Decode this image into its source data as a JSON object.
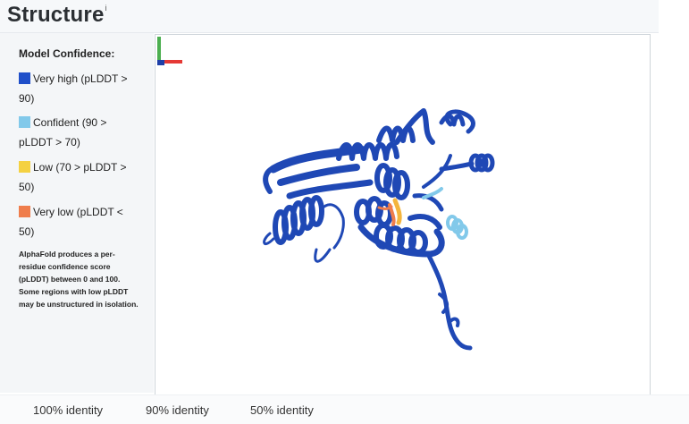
{
  "header": {
    "title": "Structure",
    "info_marker": "i"
  },
  "legend": {
    "title": "Model Confidence:",
    "items": [
      {
        "label": "Very high (pLDDT > 90)",
        "line1": "Very high (pLDDT >",
        "line2": "90)",
        "color": "#1f4fc9"
      },
      {
        "label": "Confident (90 > pLDDT > 70)",
        "line1": "Confident (90 >",
        "line2": "pLDDT > 70)",
        "color": "#82c9ea"
      },
      {
        "label": "Low (70 > pLDDT > 50)",
        "line1": "Low (70 > pLDDT >",
        "line2": "50)",
        "color": "#f4d142"
      },
      {
        "label": "Very low (pLDDT < 50)",
        "line1": "Very low (pLDDT <",
        "line2": "50)",
        "color": "#ef7d4c"
      }
    ],
    "note_lines": [
      "AlphaFold produces a per-",
      "residue confidence score",
      "(pLDDT) between 0 and 100.",
      "Some regions with low pLDDT",
      "may be unstructured in isolation."
    ]
  },
  "viewer": {
    "main_color": "#1f48b5",
    "accent_light": "#82c9ea",
    "accent_low": "#f4b53d",
    "accent_verylow": "#ef7d4c"
  },
  "footer": {
    "identity_labels": [
      "100% identity",
      "90% identity",
      "50% identity"
    ]
  }
}
